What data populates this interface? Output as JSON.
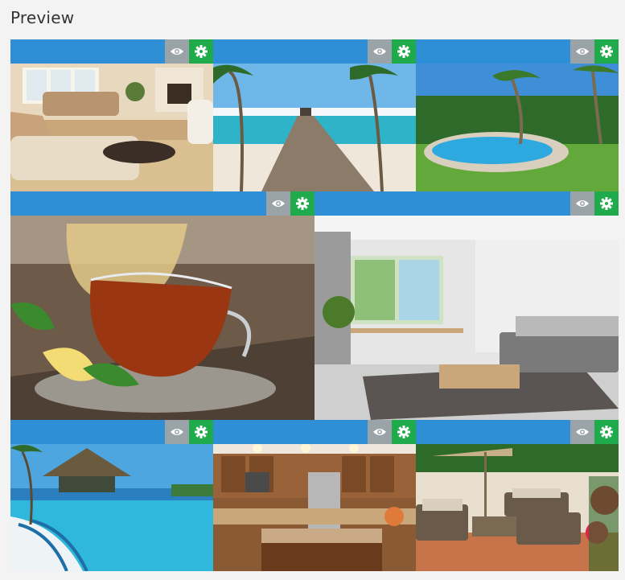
{
  "page": {
    "title": "Preview"
  },
  "colors": {
    "bar": "#2f8fd6",
    "view_button": "#9aa3a8",
    "settings_button": "#1faa4b"
  },
  "icons": {
    "view": "eye-icon",
    "settings": "gear-icon"
  },
  "tiles": [
    {
      "subject": "living-room"
    },
    {
      "subject": "beach-pier"
    },
    {
      "subject": "pool-garden"
    },
    {
      "subject": "tea-cup"
    },
    {
      "subject": "modern-interior"
    },
    {
      "subject": "resort-pool"
    },
    {
      "subject": "kitchen"
    },
    {
      "subject": "patio"
    }
  ]
}
